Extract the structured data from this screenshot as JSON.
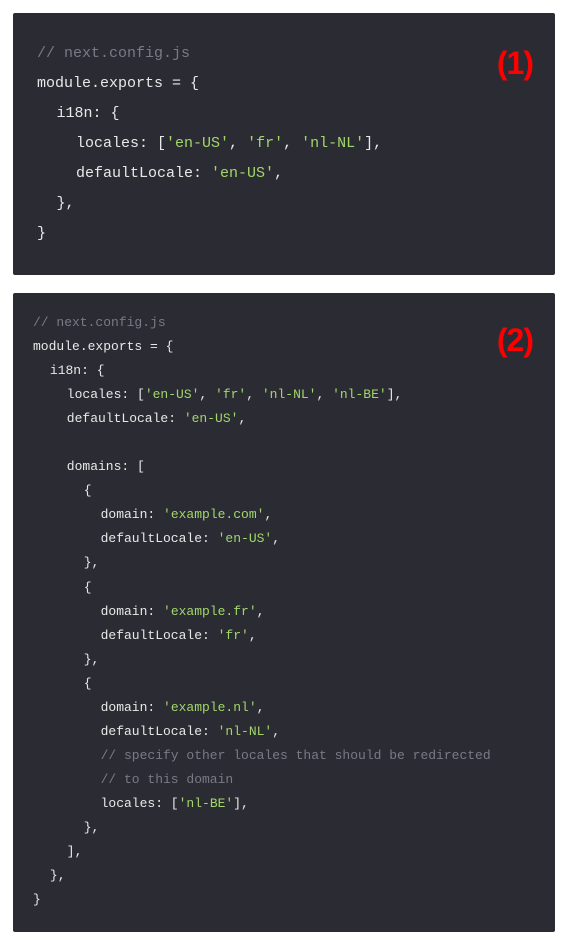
{
  "block1": {
    "badge": "(1)",
    "lines": {
      "l0": "// next.config.js",
      "l1a": "module",
      "l1b": ".",
      "l1c": "exports",
      "l1d": " = {",
      "l2a": "i18n",
      "l2b": ": {",
      "l3a": "locales",
      "l3b": ": [",
      "l3c": "'en-US'",
      "l3d": ", ",
      "l3e": "'fr'",
      "l3f": ", ",
      "l3g": "'nl-NL'",
      "l3h": "],",
      "l4a": "defaultLocale",
      "l4b": ": ",
      "l4c": "'en-US'",
      "l4d": ",",
      "l5": "},",
      "l6": "}"
    }
  },
  "block2": {
    "badge": "(2)",
    "lines": {
      "l0": "// next.config.js",
      "l1a": "module",
      "l1b": ".",
      "l1c": "exports",
      "l1d": " = {",
      "l2a": "i18n",
      "l2b": ": {",
      "l3a": "locales",
      "l3b": ": [",
      "l3c": "'en-US'",
      "l3d": ", ",
      "l3e": "'fr'",
      "l3f": ", ",
      "l3g": "'nl-NL'",
      "l3h": ", ",
      "l3i": "'nl-BE'",
      "l3j": "],",
      "l4a": "defaultLocale",
      "l4b": ": ",
      "l4c": "'en-US'",
      "l4d": ",",
      "blank1": " ",
      "l5a": "domains",
      "l5b": ": [",
      "l6": "{",
      "l7a": "domain",
      "l7b": ": ",
      "l7c": "'example.com'",
      "l7d": ",",
      "l8a": "defaultLocale",
      "l8b": ": ",
      "l8c": "'en-US'",
      "l8d": ",",
      "l9": "},",
      "l10": "{",
      "l11a": "domain",
      "l11b": ": ",
      "l11c": "'example.fr'",
      "l11d": ",",
      "l12a": "defaultLocale",
      "l12b": ": ",
      "l12c": "'fr'",
      "l12d": ",",
      "l13": "},",
      "l14": "{",
      "l15a": "domain",
      "l15b": ": ",
      "l15c": "'example.nl'",
      "l15d": ",",
      "l16a": "defaultLocale",
      "l16b": ": ",
      "l16c": "'nl-NL'",
      "l16d": ",",
      "l17": "// specify other locales that should be redirected",
      "l18": "// to this domain",
      "l19a": "locales",
      "l19b": ": [",
      "l19c": "'nl-BE'",
      "l19d": "],",
      "l20": "},",
      "l21": "],",
      "l22": "},",
      "l23": "}"
    }
  }
}
